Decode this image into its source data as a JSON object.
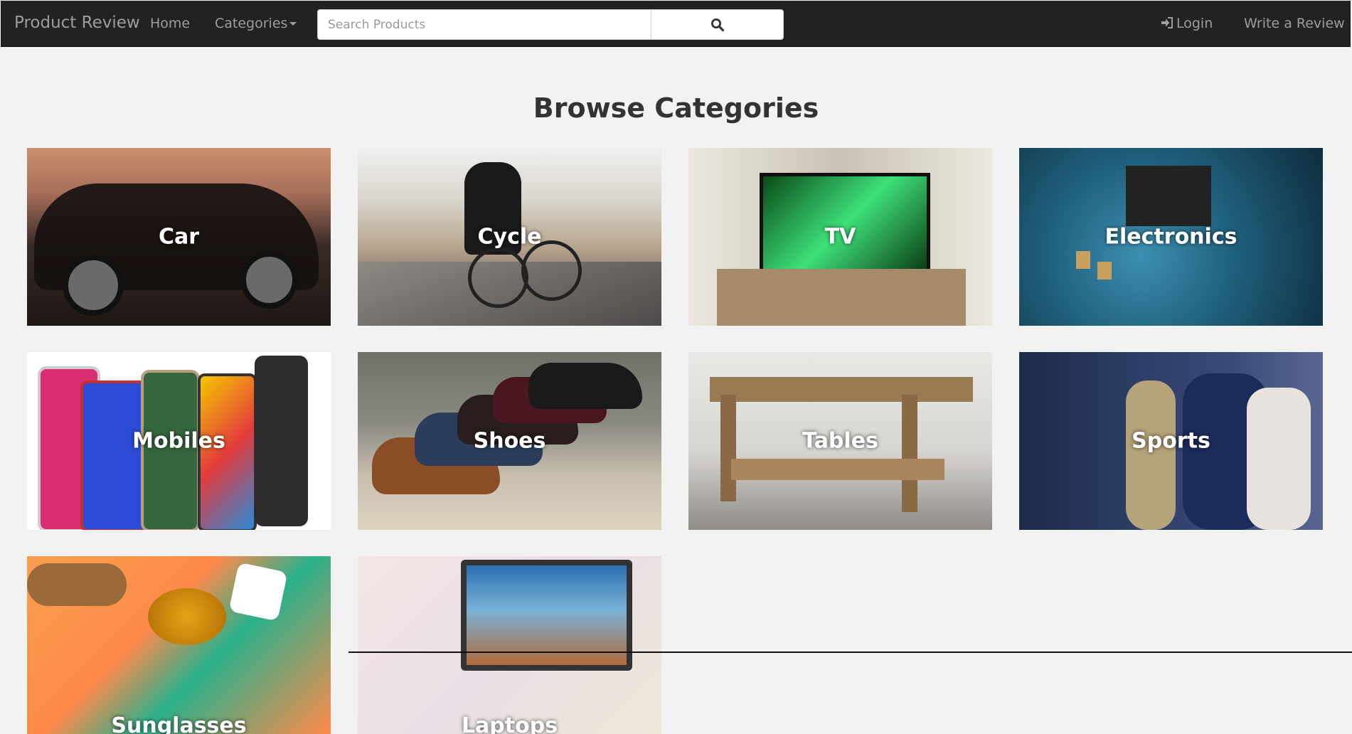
{
  "navbar": {
    "brand": "Product Review",
    "links": {
      "home": "Home",
      "categories": "Categories"
    },
    "search": {
      "placeholder": "Search Products",
      "value": "",
      "icon": "search-icon"
    },
    "right": {
      "login": "Login",
      "login_icon": "sign-in-icon",
      "write_review": "Write a Review"
    }
  },
  "page": {
    "title": "Browse Categories"
  },
  "categories": [
    {
      "label": "Car"
    },
    {
      "label": "Cycle"
    },
    {
      "label": "TV"
    },
    {
      "label": "Electronics"
    },
    {
      "label": "Mobiles"
    },
    {
      "label": "Shoes"
    },
    {
      "label": "Tables"
    },
    {
      "label": "Sports"
    },
    {
      "label": "Sunglasses"
    },
    {
      "label": "Laptops"
    }
  ],
  "colors": {
    "navbar": "#222222",
    "nav_text": "#9d9d9d",
    "background": "#f2f2f2",
    "title": "#333333"
  }
}
